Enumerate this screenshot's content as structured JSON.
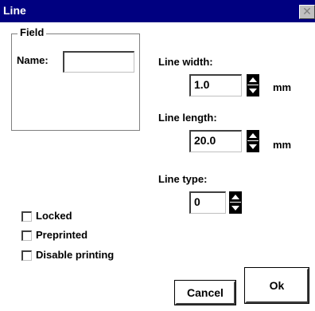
{
  "window": {
    "title": "Line",
    "close_glyph": "✕"
  },
  "field_group": {
    "legend": "Field",
    "name_label": "Name:",
    "name_value": ""
  },
  "line_width": {
    "label": "Line width:",
    "value": "1.0",
    "unit": "mm"
  },
  "line_length": {
    "label": "Line length:",
    "value": "20.0",
    "unit": "mm"
  },
  "line_type": {
    "label": "Line type:",
    "value": "0"
  },
  "checkboxes": [
    {
      "label": "Locked",
      "checked": false
    },
    {
      "label": "Preprinted",
      "checked": false
    },
    {
      "label": "Disable printing",
      "checked": false
    }
  ],
  "buttons": {
    "cancel": "Cancel",
    "ok": "Ok"
  },
  "icons": {
    "close": "close-icon",
    "spin_up": "spin-up-icon",
    "spin_down": "spin-down-icon"
  }
}
